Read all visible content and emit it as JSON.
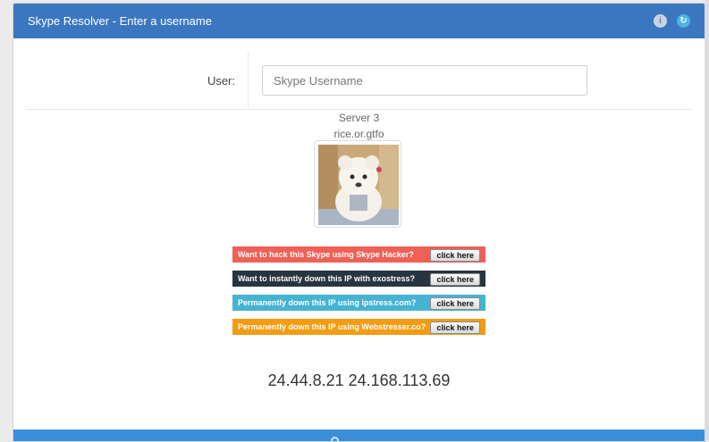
{
  "header": {
    "title": "Skype Resolver - Enter a username",
    "info_icon": "info-icon",
    "refresh_icon": "refresh-icon",
    "color": "#3a77c0"
  },
  "form": {
    "user_label": "User:",
    "user_placeholder": "Skype Username",
    "user_value": ""
  },
  "server": {
    "name": "Server 3",
    "host": "rice.or.gtfo"
  },
  "ads": [
    {
      "text": "Want to hack this Skype using Skype Hacker?",
      "button": "click here",
      "color": "#f06057"
    },
    {
      "text": "Want to instantly down this IP with exostress?",
      "button": "click here",
      "color": "#263540"
    },
    {
      "text": "Permanently down this IP using ipstress.com?",
      "button": "click here",
      "color": "#45b3d2"
    },
    {
      "text": "Permanently down this IP using Webstresser.co?",
      "button": "click here",
      "color": "#f39c12"
    }
  ],
  "result": {
    "ips": "24.44.8.21 24.168.113.69"
  },
  "footer": {
    "icon": "search-icon",
    "color": "#3a8fdb"
  }
}
